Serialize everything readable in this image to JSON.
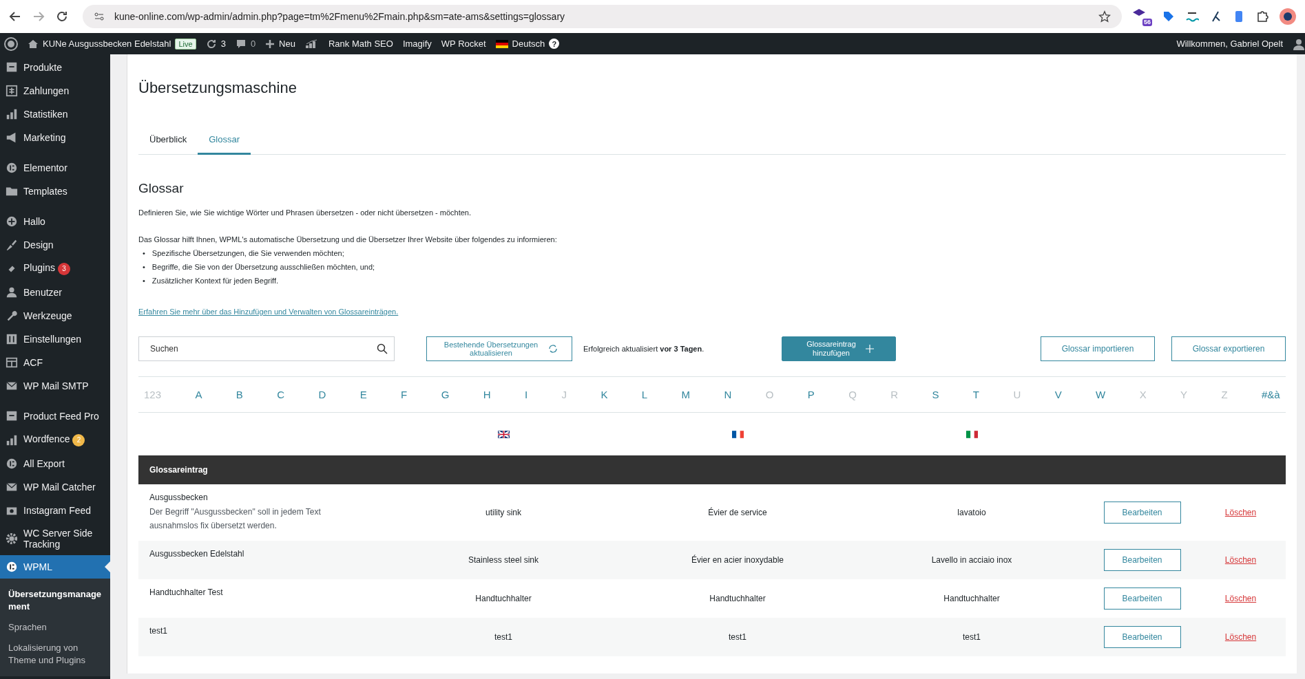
{
  "browser": {
    "url": "kune-online.com/wp-admin/admin.php?page=tm%2Fmenu%2Fmain.php&sm=ate-ams&settings=glossary",
    "extension_badge": "56"
  },
  "admin_bar": {
    "site": "KUNe Ausgussbecken Edelstahl",
    "live": "Live",
    "updates": "3",
    "comments": "0",
    "new": "Neu",
    "items": [
      "Rank Math SEO",
      "Imagify",
      "WP Rocket"
    ],
    "language": "Deutsch",
    "help": "?",
    "greeting": "Willkommen, Gabriel Opelt"
  },
  "sidebar": {
    "groups": [
      [
        {
          "label": "Produkte",
          "selected": false
        },
        {
          "label": "Zahlungen",
          "selected": false
        },
        {
          "label": "Statistiken",
          "selected": false
        },
        {
          "label": "Marketing",
          "selected": false
        }
      ],
      [
        {
          "label": "Elementor",
          "selected": false
        },
        {
          "label": "Templates",
          "selected": false
        }
      ],
      [
        {
          "label": "Hallo",
          "selected": false
        },
        {
          "label": "Design",
          "selected": false
        },
        {
          "label": "Plugins",
          "selected": false,
          "badge": "3",
          "color": "#d63638"
        },
        {
          "label": "Benutzer",
          "selected": false
        },
        {
          "label": "Werkzeuge",
          "selected": false
        },
        {
          "label": "Einstellungen",
          "selected": false
        },
        {
          "label": "ACF",
          "selected": false
        },
        {
          "label": "WP Mail SMTP",
          "selected": false
        }
      ],
      [
        {
          "label": "Product Feed Pro",
          "selected": false
        },
        {
          "label": "Wordfence",
          "selected": false,
          "badge": "2",
          "color": "#f0b849"
        },
        {
          "label": "All Export",
          "selected": false
        },
        {
          "label": "WP Mail Catcher",
          "selected": false
        },
        {
          "label": "Instagram Feed",
          "selected": false
        },
        {
          "label": "WC Server Side Tracking",
          "selected": false
        },
        {
          "label": "WPML",
          "selected": true
        }
      ]
    ],
    "submenu": [
      {
        "label": "Übersetzungsmanagement",
        "selected": true
      },
      {
        "label": "Sprachen",
        "selected": false
      },
      {
        "label": "Lokalisierung von Theme und Plugins",
        "selected": false
      }
    ]
  },
  "page": {
    "title": "Übersetzungsmaschine",
    "tabs": [
      {
        "label": "Überblick",
        "selected": false
      },
      {
        "label": "Glossar",
        "selected": true
      }
    ],
    "heading": "Glossar",
    "intro": "Definieren Sie, wie Sie wichtige Wörter und Phrasen übersetzen - oder nicht übersetzen - möchten.",
    "help_lead": "Das Glossar hilft Ihnen, WPML's automatische Übersetzung und die Übersetzer Ihrer Website über folgendes zu informieren:",
    "bullets": [
      {
        "marker": "•",
        "text": "Spezifische Übersetzungen, die Sie verwenden möchten;"
      },
      {
        "marker": "•",
        "text": "Begriffe, die Sie von der Übersetzung ausschließen möchten, und;"
      },
      {
        "marker": "•",
        "text": "Zusätzlicher Kontext für jeden Begriff."
      }
    ],
    "learn_more": "Erfahren Sie mehr über das Hinzufügen und Verwalten von Glossareinträgen.",
    "search": {
      "placeholder": "Suchen"
    },
    "refresh_button": "Bestehende Übersetzungen aktualisieren",
    "status": "Erfolgreich aktualisiert **vor 3 Tagen**.",
    "add_button": "Glossareintrag hinzufügen",
    "import_button": "Glossar importieren",
    "export_button": "Glossar exportieren",
    "letters": [
      {
        "label": "123",
        "disabled": true
      },
      {
        "label": "A",
        "disabled": false
      },
      {
        "label": "B",
        "disabled": false
      },
      {
        "label": "C",
        "disabled": false
      },
      {
        "label": "D",
        "disabled": false
      },
      {
        "label": "E",
        "disabled": false
      },
      {
        "label": "F",
        "disabled": false
      },
      {
        "label": "G",
        "disabled": false
      },
      {
        "label": "H",
        "disabled": false
      },
      {
        "label": "I",
        "disabled": false
      },
      {
        "label": "J",
        "disabled": true
      },
      {
        "label": "K",
        "disabled": false
      },
      {
        "label": "L",
        "disabled": false
      },
      {
        "label": "M",
        "disabled": false
      },
      {
        "label": "N",
        "disabled": false
      },
      {
        "label": "O",
        "disabled": true
      },
      {
        "label": "P",
        "disabled": false
      },
      {
        "label": "Q",
        "disabled": true
      },
      {
        "label": "R",
        "disabled": true
      },
      {
        "label": "S",
        "disabled": false
      },
      {
        "label": "T",
        "disabled": false
      },
      {
        "label": "U",
        "disabled": true
      },
      {
        "label": "V",
        "disabled": false
      },
      {
        "label": "W",
        "disabled": false
      },
      {
        "label": "X",
        "disabled": true
      },
      {
        "label": "Y",
        "disabled": true
      },
      {
        "label": "Z",
        "disabled": true
      },
      {
        "label": "#&à",
        "disabled": false
      }
    ],
    "table": {
      "header": "Glossareintrag",
      "rows": [
        {
          "term": "Ausgussbecken",
          "description": "Der Begriff \"Ausgussbecken\" soll in jedem Text ausnahmslos fix übersetzt werden.",
          "translations": [
            "utility sink",
            "Évier de service",
            "lavatoio"
          ],
          "edit": "Bearbeiten",
          "delete": "Löschen"
        },
        {
          "term": "Ausgussbecken Edelstahl",
          "translations": [
            "Stainless steel sink",
            "Évier en acier inoxydable",
            "Lavello in acciaio inox"
          ],
          "edit": "Bearbeiten",
          "delete": "Löschen"
        },
        {
          "term": "Handtuchhalter Test",
          "translations": [
            "Handtuchhalter",
            "Handtuchhalter",
            "Handtuchhalter"
          ],
          "edit": "Bearbeiten",
          "delete": "Löschen"
        },
        {
          "term": "test1",
          "translations": [
            "test1",
            "test1",
            "test1"
          ],
          "edit": "Bearbeiten",
          "delete": "Löschen"
        }
      ]
    }
  }
}
